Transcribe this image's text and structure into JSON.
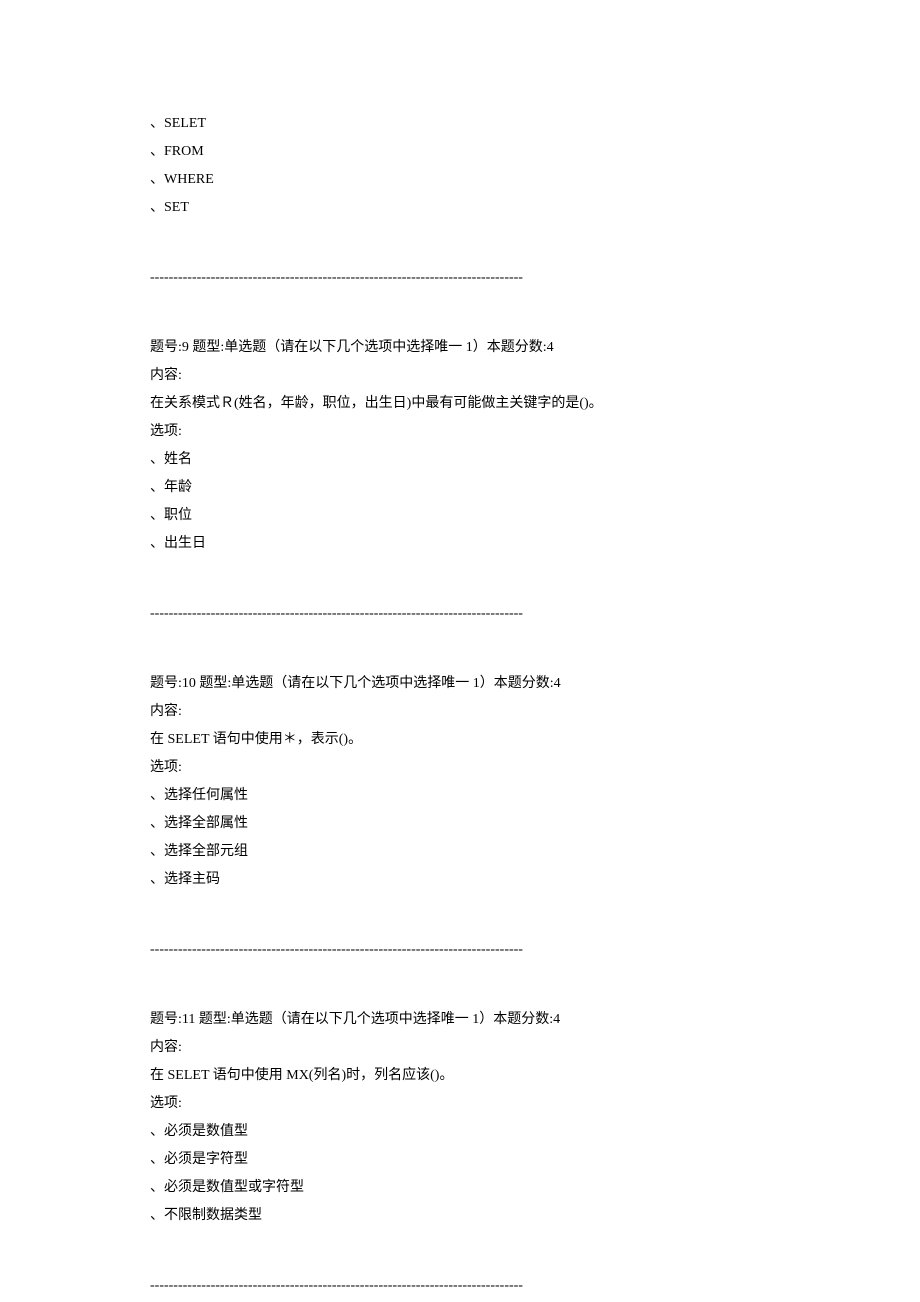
{
  "q8_fragment": {
    "options": [
      "、SELET",
      "、FROM",
      "、WHERE",
      "、SET"
    ]
  },
  "separator": "--------------------------------------------------------------------------------",
  "q9": {
    "header": "题号:9 题型:单选题（请在以下几个选项中选择唯一 1）本题分数:4",
    "content_label": "内容:",
    "content": "在关系模式Ｒ(姓名，年龄，职位，出生日)中最有可能做主关键字的是()。",
    "options_label": "选项:",
    "options": [
      "、姓名",
      "、年龄",
      "、职位",
      "、出生日"
    ]
  },
  "q10": {
    "header": "题号:10 题型:单选题（请在以下几个选项中选择唯一 1）本题分数:4",
    "content_label": "内容:",
    "content": "在 SELET 语句中使用＊，表示()。",
    "options_label": "选项:",
    "options": [
      "、选择任何属性",
      "、选择全部属性",
      "、选择全部元组",
      "、选择主码"
    ]
  },
  "q11": {
    "header": "题号:11 题型:单选题（请在以下几个选项中选择唯一 1）本题分数:4",
    "content_label": "内容:",
    "content": "在 SELET 语句中使用 MX(列名)时，列名应该()。",
    "options_label": "选项:",
    "options": [
      "、必须是数值型",
      "、必须是字符型",
      "、必须是数值型或字符型",
      "、不限制数据类型"
    ]
  }
}
